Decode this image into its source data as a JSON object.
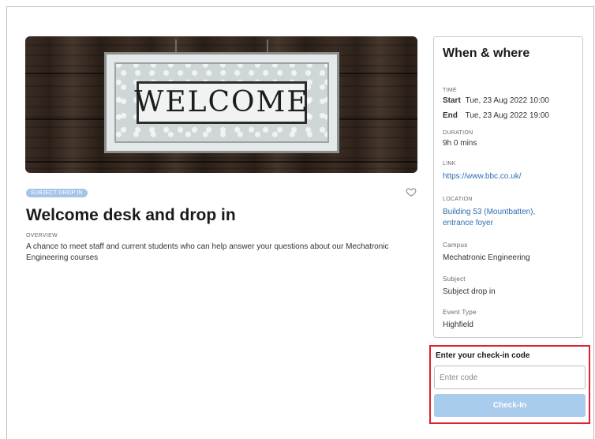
{
  "hero": {
    "sign_text": "WELCOME"
  },
  "event": {
    "badge": "SUBJECT DROP IN",
    "title": "Welcome desk and drop in",
    "overview_label": "OVERVIEW",
    "overview_text": "A chance to meet staff and current students who can help answer your questions about our Mechatronic Engineering courses"
  },
  "details": {
    "heading": "When & where",
    "time_label": "TIME",
    "start_key": "Start",
    "start_value": "Tue, 23 Aug 2022 10:00",
    "end_key": "End",
    "end_value": "Tue, 23 Aug 2022 19:00",
    "duration_label": "DURATION",
    "duration_value": "9h 0 mins",
    "link_label": "LINK",
    "link_value": "https://www.bbc.co.uk/",
    "location_label": "LOCATION",
    "location_value": "Building 53 (Mountbatten), entrance foyer",
    "campus_label": "Campus",
    "campus_value": "Mechatronic Engineering",
    "subject_label": "Subject",
    "subject_value": "Subject drop in",
    "event_type_label": "Event Type",
    "event_type_value": "Highfield"
  },
  "checkin": {
    "label": "Enter your check-in code",
    "placeholder": "Enter code",
    "button_label": "Check-In"
  },
  "colors": {
    "badge": "#a6c4e8",
    "link": "#2f6db0",
    "button": "#a9cbec",
    "highlight": "#e0202a"
  }
}
